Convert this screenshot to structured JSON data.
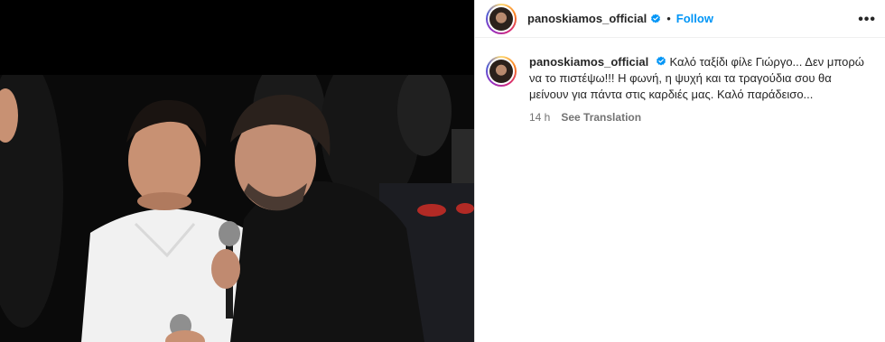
{
  "post": {
    "username": "panoskiamos_official",
    "follow_label": "Follow",
    "separator": "•",
    "more_label": "•••",
    "caption": "Καλό ταξίδι φίλε Γιώργο... Δεν μπορώ να το πιστέψω!!! Η φωνή, η ψυχή και τα τραγούδια σου θα μείνουν για πάντα στις καρδιές μας. Καλό παράδεισο...",
    "time_ago": "14 h",
    "see_translation_label": "See Translation"
  },
  "colors": {
    "link_blue": "#0095f6",
    "verified_blue": "#0095f6",
    "muted_text": "#737373"
  },
  "icons": {
    "verified": "verified-badge-icon",
    "more": "more-options-icon"
  }
}
